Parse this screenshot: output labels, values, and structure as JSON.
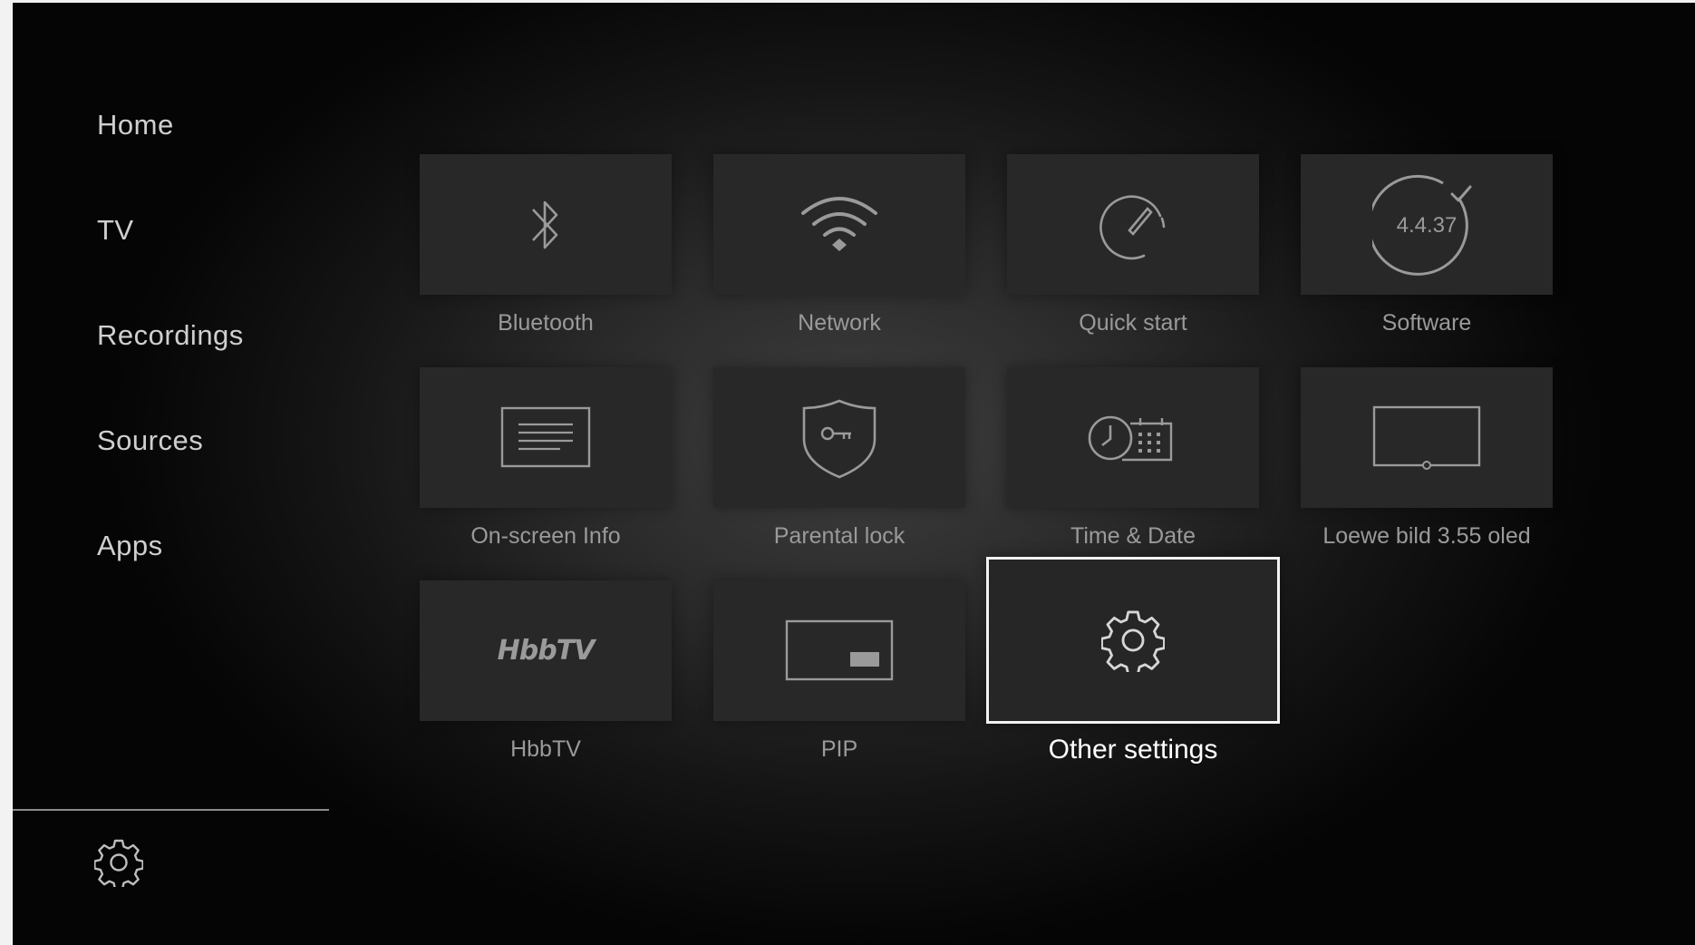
{
  "sidebar": {
    "items": [
      {
        "label": "Home"
      },
      {
        "label": "TV"
      },
      {
        "label": "Recordings"
      },
      {
        "label": "Sources"
      },
      {
        "label": "Apps"
      }
    ],
    "settings_icon": "gear-icon"
  },
  "tiles": [
    {
      "label": "Bluetooth",
      "icon": "bluetooth-icon"
    },
    {
      "label": "Network",
      "icon": "wifi-icon"
    },
    {
      "label": "Quick start",
      "icon": "speedometer-icon"
    },
    {
      "label": "Software",
      "icon": "software-version-icon",
      "version": "4.4.37"
    },
    {
      "label": "On-screen Info",
      "icon": "text-panel-icon"
    },
    {
      "label": "Parental lock",
      "icon": "shield-key-icon"
    },
    {
      "label": "Time & Date",
      "icon": "clock-calendar-icon"
    },
    {
      "label": "Loewe bild 3.55 oled",
      "icon": "tv-screen-icon"
    },
    {
      "label": "HbbTV",
      "icon": "hbbtv-logo",
      "logo_text": "HbbTV"
    },
    {
      "label": "PIP",
      "icon": "picture-in-picture-icon"
    },
    {
      "label": "Other settings",
      "icon": "gear-icon",
      "focused": true
    }
  ],
  "colors": {
    "focus_border": "#f2f2f2",
    "tile_bg": "#282828",
    "label": "#9a9a9a",
    "nav_text": "#cfcfcf"
  }
}
